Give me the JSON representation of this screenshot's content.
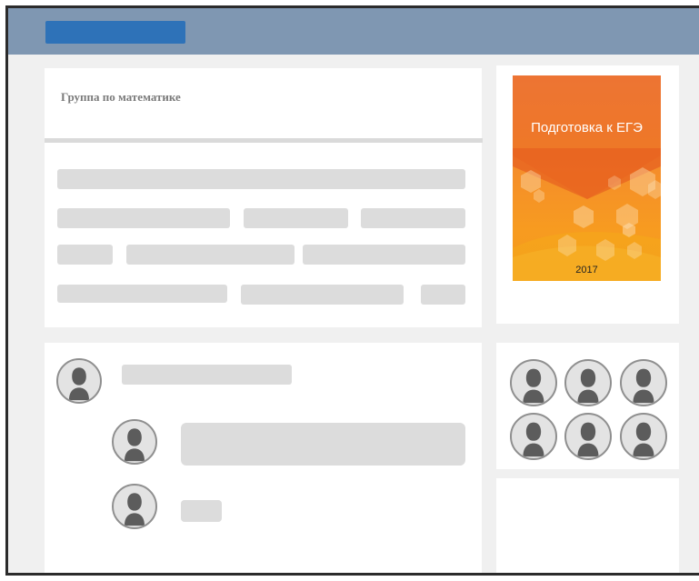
{
  "group": {
    "title": "Группа по математике"
  },
  "poster": {
    "title": "Подготовка к ЕГЭ",
    "year": "2017",
    "colors": {
      "top": "#f08445",
      "bottom": "#f79b20",
      "chevron": "#e2521e"
    }
  },
  "colors": {
    "header": "#7f97b2",
    "header_button": "#2e72b8",
    "placeholder": "#dcdcdc",
    "background": "#f0f0f0"
  },
  "icons": {
    "avatar": "user-avatar-icon"
  }
}
